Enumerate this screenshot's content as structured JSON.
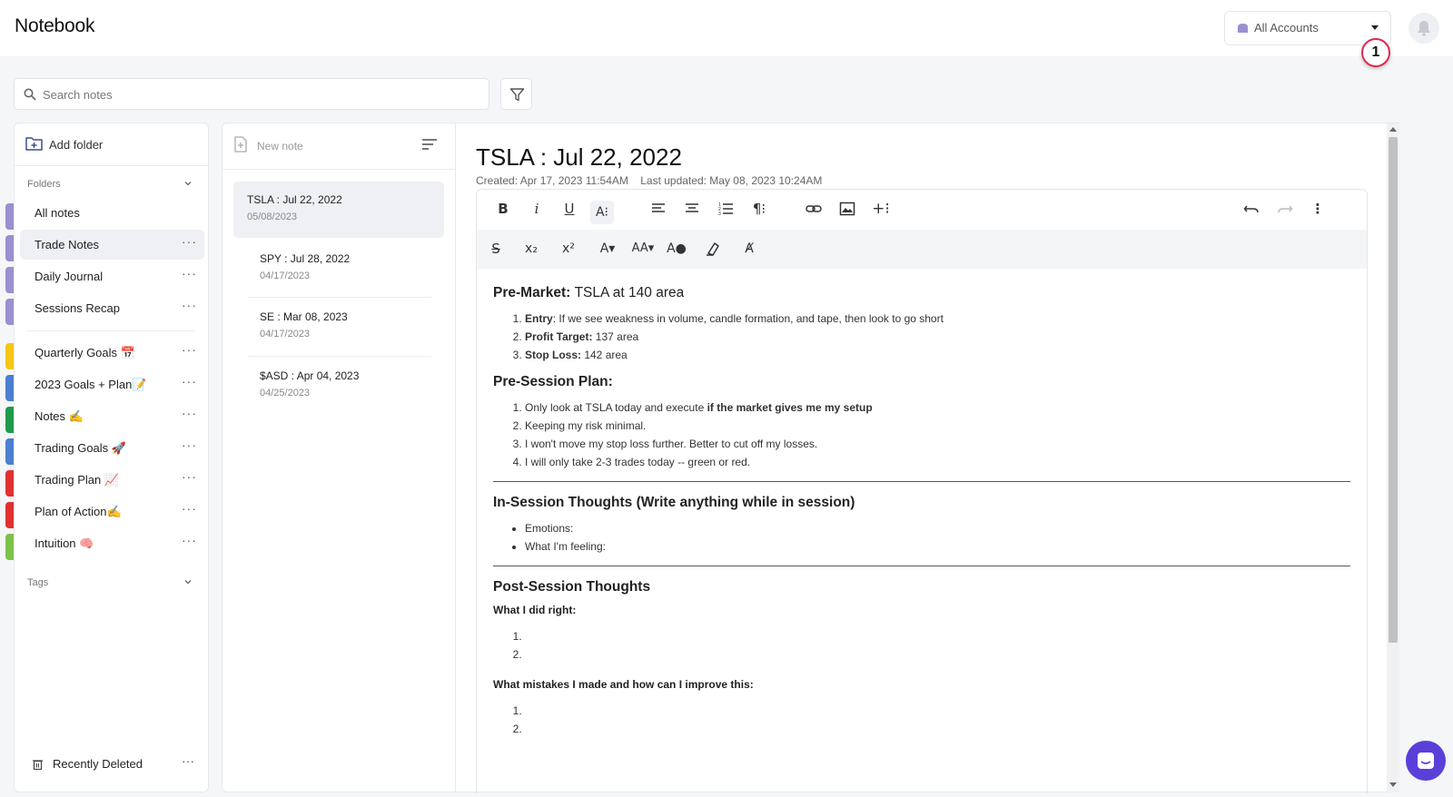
{
  "app": {
    "title": "Notebook"
  },
  "header": {
    "account_selector": "All Accounts",
    "notification_badge": "1"
  },
  "search": {
    "placeholder": "Search notes"
  },
  "folders_panel": {
    "add_folder_label": "Add folder",
    "folders_label": "Folders",
    "tags_label": "Tags",
    "items": [
      {
        "label": "All notes",
        "color": "#9b8fd0",
        "active": false
      },
      {
        "label": "Trade Notes",
        "color": "#9b8fd0",
        "active": true
      },
      {
        "label": "Daily Journal",
        "color": "#9b8fd0",
        "active": false
      },
      {
        "label": "Sessions Recap",
        "color": "#9b8fd0",
        "active": false
      },
      {
        "label": "Quarterly Goals 📅",
        "color": "#f5c518",
        "active": false
      },
      {
        "label": "2023 Goals + Plan📝",
        "color": "#4a7fd1",
        "active": false
      },
      {
        "label": "Notes ✍️",
        "color": "#1f9a4a",
        "active": false
      },
      {
        "label": "Trading Goals 🚀",
        "color": "#4a7fd1",
        "active": false
      },
      {
        "label": "Trading Plan 📈",
        "color": "#e03131",
        "active": false
      },
      {
        "label": "Plan of Action✍️",
        "color": "#e03131",
        "active": false
      },
      {
        "label": "Intuition 🧠",
        "color": "#7cc24a",
        "active": false
      }
    ],
    "recently_deleted_label": "Recently Deleted"
  },
  "notes_panel": {
    "new_note_label": "New note",
    "notes": [
      {
        "title": "TSLA : Jul 22, 2022",
        "date": "05/08/2023",
        "active": true
      },
      {
        "title": "SPY : Jul 28, 2022",
        "date": "04/17/2023",
        "active": false
      },
      {
        "title": "SE : Mar 08, 2023",
        "date": "04/17/2023",
        "active": false
      },
      {
        "title": "$ASD : Apr 04, 2023",
        "date": "04/25/2023",
        "active": false
      }
    ]
  },
  "editor": {
    "title": "TSLA : Jul 22, 2022",
    "created": "Created: Apr 17, 2023 11:54AM",
    "updated": "Last updated: May 08, 2023 10:24AM",
    "toolbar_row1": [
      "bold-icon",
      "italic-icon",
      "underline-icon",
      "font-size-icon",
      "align-left-icon",
      "align-center-icon",
      "ordered-list-icon",
      "paragraph-icon",
      "link-icon",
      "image-icon",
      "insert-icon",
      "undo-icon",
      "redo-icon",
      "more-icon"
    ],
    "toolbar_row2": [
      "strikethrough-icon",
      "subscript-icon",
      "superscript-icon",
      "font-color-icon",
      "text-case-icon",
      "highlight-icon",
      "eraser-icon",
      "clear-format-icon"
    ],
    "content": {
      "premarket_heading": "Pre-Market:",
      "premarket_heading_rest": "TSLA at 140 area",
      "premarket_list": [
        {
          "bold": "Entry",
          "text": ": If we see weakness in volume, candle formation, and tape, then look to go short"
        },
        {
          "bold": "Profit Target:",
          "text": " 137 area"
        },
        {
          "bold": "Stop Loss:",
          "text": " 142 area"
        }
      ],
      "presession_heading": "Pre-Session Plan:",
      "presession_item1_text": "Only look at TSLA today and execute ",
      "presession_item1_bold": "if the market gives me my setup",
      "presession_list_rest": [
        "Keeping my risk minimal.",
        "I won't move my stop loss further. Better to cut off my losses.",
        "I will only take 2-3 trades today -- green or red."
      ],
      "insession_heading": "In-Session Thoughts (Write anything while in session)",
      "insession_list": [
        "Emotions:",
        "What I'm feeling:"
      ],
      "postsession_heading": "Post-Session Thoughts",
      "did_right_label": "What I did right:",
      "mistakes_label": "What mistakes I made and how can I improve this:"
    }
  }
}
